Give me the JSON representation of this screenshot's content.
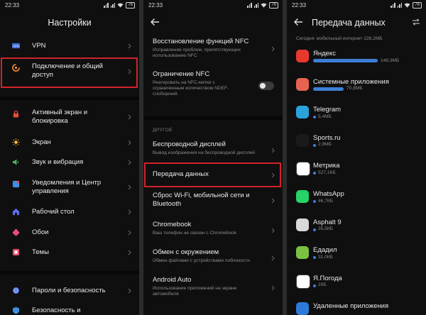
{
  "status": {
    "time": "22:33",
    "battery": "76"
  },
  "screen1": {
    "title": "Настройки",
    "items": [
      {
        "label": "VPN"
      },
      {
        "label": "Подключение и общий доступ"
      },
      {
        "label": "Активный экран и блокировка"
      },
      {
        "label": "Экран"
      },
      {
        "label": "Звук и вибрация"
      },
      {
        "label": "Уведомления и Центр управления"
      },
      {
        "label": "Рабочий стол"
      },
      {
        "label": "Обои"
      },
      {
        "label": "Темы"
      },
      {
        "label": "Пароли и безопасность"
      },
      {
        "label": "Безопасность и"
      }
    ]
  },
  "screen2": {
    "items": [
      {
        "label": "Восстановление функций NFC",
        "sub": "Исправление проблем, препятствующих использованию NFC"
      },
      {
        "label": "Ограничение NFC",
        "sub": "Реагировать на NFC-метки с ограниченным количеством NDEF-сообщений."
      },
      {
        "label": "Беспроводной дисплей",
        "sub": "Вывод изображения на беспроводной дисплей"
      },
      {
        "label": "Передача данных"
      },
      {
        "label": "Сброс Wi-Fi, мобильной сети и Bluetooth"
      },
      {
        "label": "Chromebook",
        "sub": "Ваш телефон не связан с Chromebook"
      },
      {
        "label": "Обмен с окружением",
        "sub": "Обмен файлами с устройствами поблизости"
      },
      {
        "label": "Android Auto",
        "sub": "Использование приложений на экране автомобиля"
      }
    ],
    "section": "ДРУГОЕ"
  },
  "screen3": {
    "title": "Передача данных",
    "today": "Сегодня: мобильный интернет 228,2МБ",
    "apps": [
      {
        "name": "Яндекс",
        "usage": "148,3МБ",
        "share": 0.65,
        "color": "#e8382f",
        "icon": "yandex-icon"
      },
      {
        "name": "Системные приложения",
        "usage": "70,8МБ",
        "share": 0.31,
        "color": "#e8634f",
        "icon": "system-apps-icon"
      },
      {
        "name": "Telegram",
        "usage": "5,4МБ",
        "share": 0.0,
        "color": "#2aa3dd",
        "icon": "telegram-icon"
      },
      {
        "name": "Sports.ru",
        "usage": "2,9МБ",
        "share": 0.0,
        "color": "#1a1a1a",
        "icon": "sports-ru-icon"
      },
      {
        "name": "Метрика",
        "usage": "527,1КБ",
        "share": 0.0,
        "color": "#ffffff",
        "icon": "metrika-icon"
      },
      {
        "name": "WhatsApp",
        "usage": "46,7КБ",
        "share": 0.0,
        "color": "#25d366",
        "icon": "whatsapp-icon"
      },
      {
        "name": "Asphalt 9",
        "usage": "35,5КБ",
        "share": 0.0,
        "color": "#d9d9d9",
        "icon": "asphalt-icon"
      },
      {
        "name": "Едадил",
        "usage": "31,0КБ",
        "share": 0.0,
        "color": "#7ac142",
        "icon": "edadil-icon"
      },
      {
        "name": "Я.Погода",
        "usage": "29Б",
        "share": 0.0,
        "color": "#ffffff",
        "icon": "ya-pogoda-icon"
      },
      {
        "name": "Удаленные приложения",
        "usage": "",
        "share": 0.0,
        "color": "#2d7bd8",
        "icon": "deleted-apps-icon"
      }
    ]
  }
}
